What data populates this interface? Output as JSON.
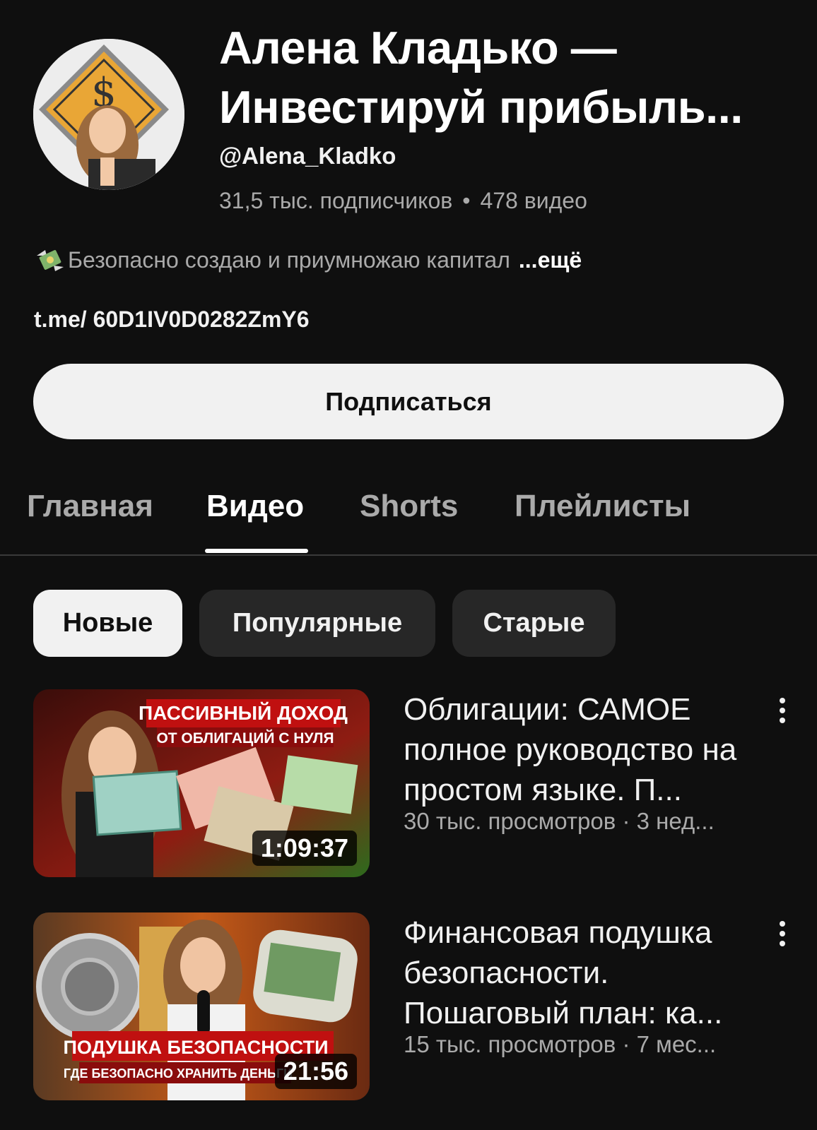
{
  "channel": {
    "title_line1": "Алена Кладько —",
    "title_line2": "Инвестируй прибыль...",
    "handle": "@Alena_Kladko",
    "subscribers": "31,5 тыс. подписчиков",
    "separator": "•",
    "video_count": "478 видео",
    "description": "Безопасно создаю и приумножаю капитал",
    "more_label": "...ещё",
    "link": "t.me/ 60D1IV0D0282ZmY6",
    "subscribe_label": "Подписаться"
  },
  "tabs": [
    {
      "label": "Главная",
      "active": false
    },
    {
      "label": "Видео",
      "active": true
    },
    {
      "label": "Shorts",
      "active": false
    },
    {
      "label": "Плейлисты",
      "active": false
    }
  ],
  "chips": [
    {
      "label": "Новые",
      "active": true
    },
    {
      "label": "Популярные",
      "active": false
    },
    {
      "label": "Старые",
      "active": false
    }
  ],
  "videos": [
    {
      "title": "Облигации: САМОЕ полное руководство на простом языке. П...",
      "meta": "30 тыс. просмотров · 3 нед...",
      "duration": "1:09:37",
      "thumb_text_1": "ПАССИВНЫЙ ДОХОД",
      "thumb_text_2": "ОТ ОБЛИГАЦИЙ С НУЛЯ"
    },
    {
      "title": "Финансовая подушка безопасности. Пошаговый план: ка...",
      "meta": "15 тыс. просмотров · 7 мес...",
      "duration": "21:56",
      "thumb_text_1": "ПОДУШКА БЕЗОПАСНОСТИ",
      "thumb_text_2": "ГДЕ БЕЗОПАСНО ХРАНИТЬ ДЕНЬГИ"
    }
  ],
  "icons": {
    "description_emoji": "money-with-wings-icon",
    "video_menu": "more-vert-icon"
  }
}
